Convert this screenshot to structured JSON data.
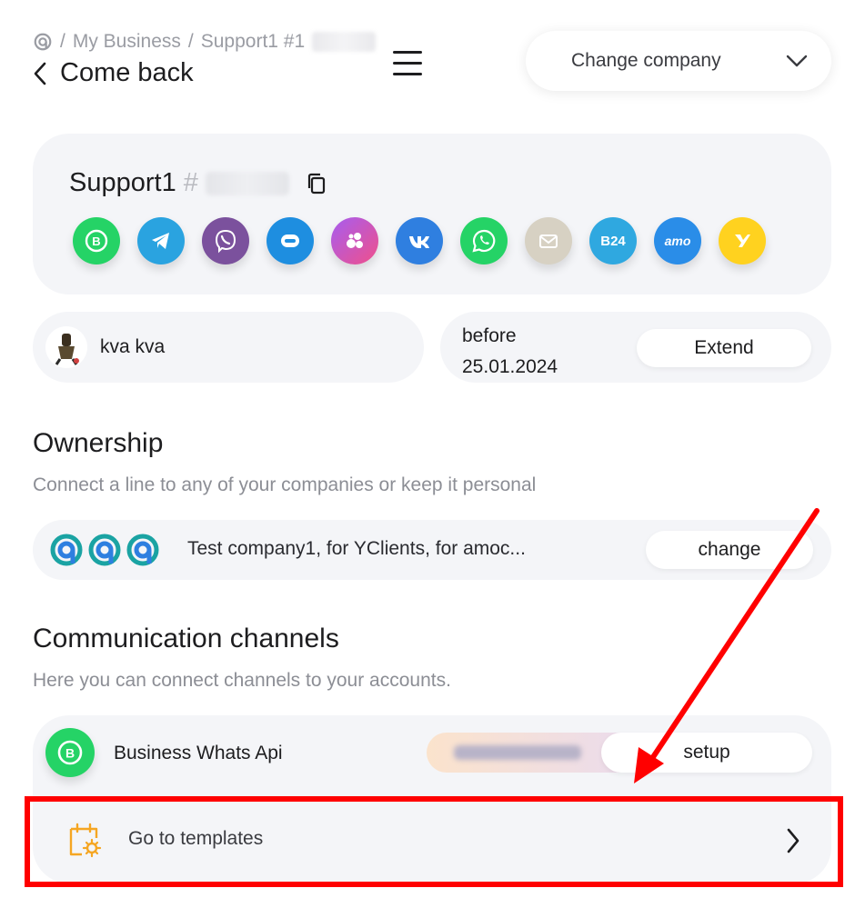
{
  "header": {
    "breadcrumb": [
      "My Business",
      "Support1 #1"
    ],
    "back_label": "Come back",
    "change_company_label": "Change company"
  },
  "account": {
    "name": "Support1",
    "hash": "#",
    "channels": [
      {
        "icon": "whatsapp-business-icon",
        "color": "#25d366"
      },
      {
        "icon": "telegram-icon",
        "color": "#2aa3e0"
      },
      {
        "icon": "viber-icon",
        "color": "#7b519d"
      },
      {
        "icon": "bot-icon",
        "color": "#1e8ee0"
      },
      {
        "icon": "dots-icon",
        "color": "#e04fb1"
      },
      {
        "icon": "vk-icon",
        "color": "#2f7fe0"
      },
      {
        "icon": "whatsapp-icon",
        "color": "#25d366"
      },
      {
        "icon": "email-icon",
        "color": "#d7d1c3"
      },
      {
        "icon": "bitrix24-icon",
        "color": "#2fa8e0",
        "text": "B24"
      },
      {
        "icon": "amocrm-icon",
        "color": "#2a8de8",
        "text": "amo"
      },
      {
        "icon": "yclients-icon",
        "color": "#ffd21f"
      }
    ]
  },
  "user": {
    "name": "kva kva"
  },
  "plan": {
    "before_label": "before",
    "date": "25.01.2024",
    "extend_label": "Extend"
  },
  "ownership": {
    "title": "Ownership",
    "subtitle": "Connect a line to any of your companies or keep it personal",
    "company_text": "Test company1, for YClients, for amoc...",
    "change_label": "change"
  },
  "channels_section": {
    "title": "Communication channels",
    "subtitle": "Here you can connect channels to your accounts.",
    "channel_name": "Business Whats Api",
    "setup_label": "setup",
    "templates_label": "Go to templates"
  },
  "colors": {
    "accent_red": "#ff0000",
    "card_bg": "#f4f5f8",
    "whatsapp_green": "#25d366",
    "template_orange": "#f5a623"
  }
}
